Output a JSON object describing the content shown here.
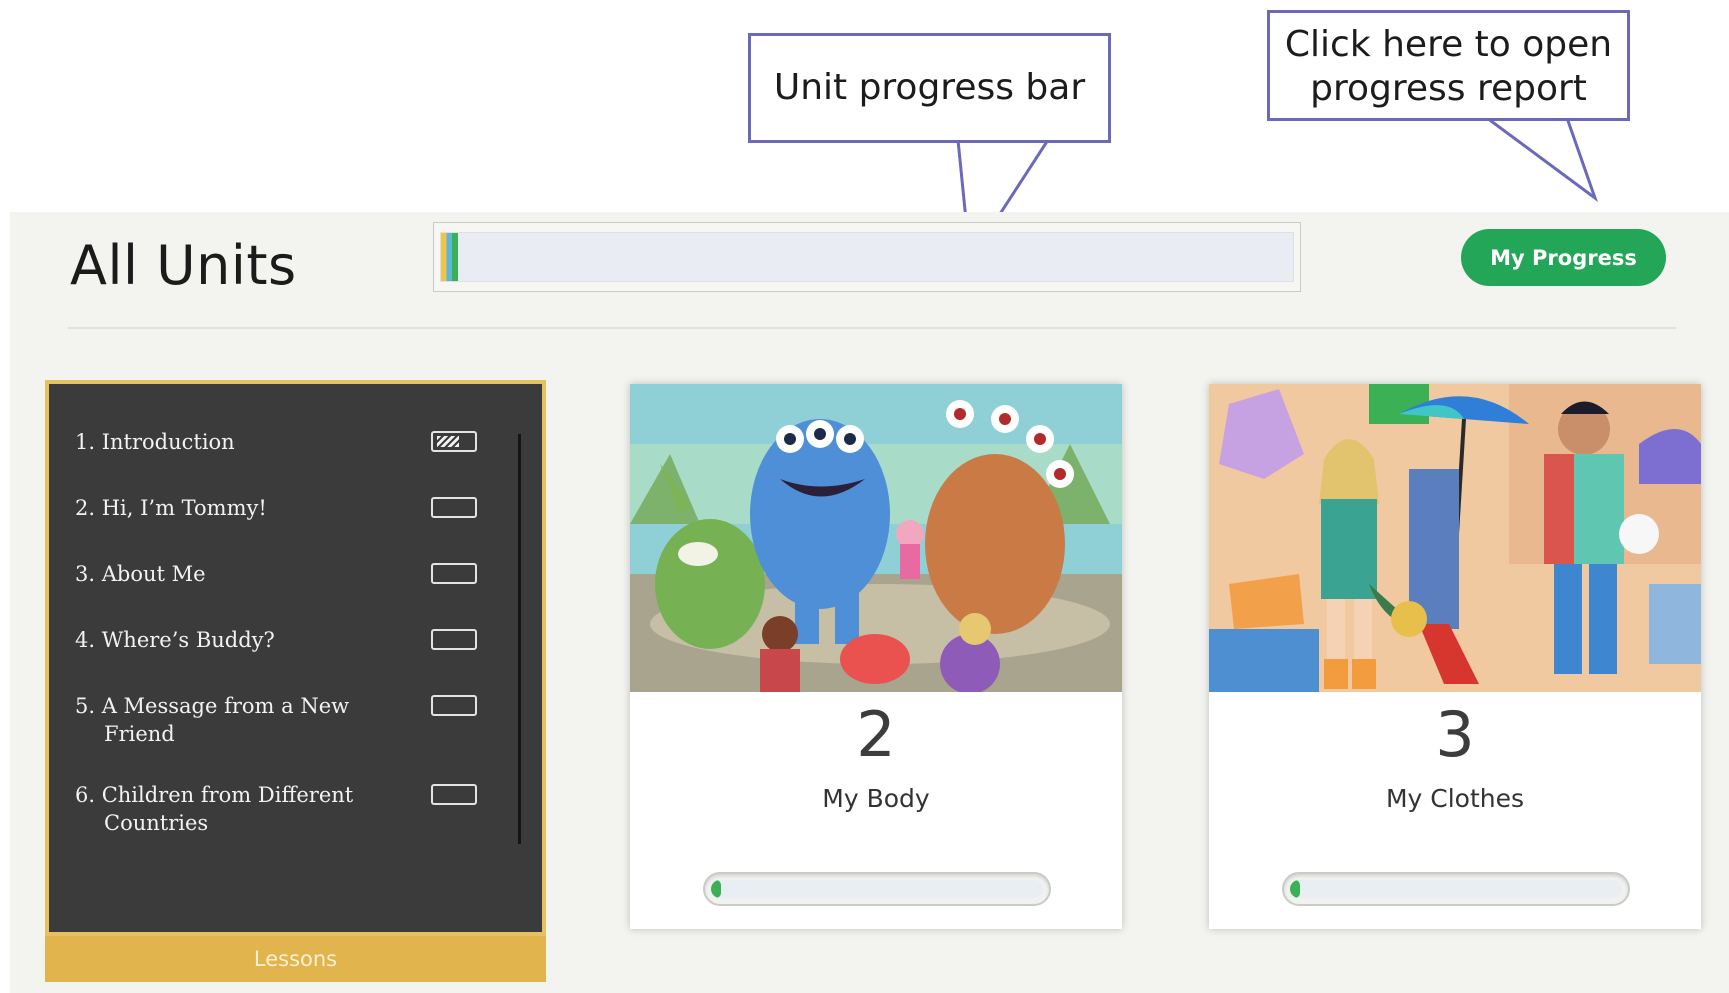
{
  "callouts": {
    "unit_bar": "Unit progress bar",
    "progress_report_line1": "Click here to open",
    "progress_report_line2": "progress report"
  },
  "header": {
    "title": "All Units",
    "unit_progress_fraction": 0.02,
    "my_progress_label": "My Progress"
  },
  "lessons": {
    "items": [
      {
        "label": "1. Introduction",
        "status": "partial"
      },
      {
        "label": "2. Hi, I’m Tommy!",
        "status": "empty"
      },
      {
        "label": "3. About Me",
        "status": "empty"
      },
      {
        "label": "4. Where’s Buddy?",
        "status": "empty"
      },
      {
        "label": "5. A Message from a New Friend",
        "status": "empty"
      },
      {
        "label": "6. Children from Different Countries",
        "status": "empty"
      }
    ],
    "footer_label": "Lessons"
  },
  "units": [
    {
      "number": "2",
      "name": "My Body",
      "progress_fraction": 0.03
    },
    {
      "number": "3",
      "name": "My Clothes",
      "progress_fraction": 0.03
    }
  ],
  "colors": {
    "accent_green": "#23a657",
    "lessons_gold": "#e1b44e",
    "callout_border": "#6a69ba"
  }
}
